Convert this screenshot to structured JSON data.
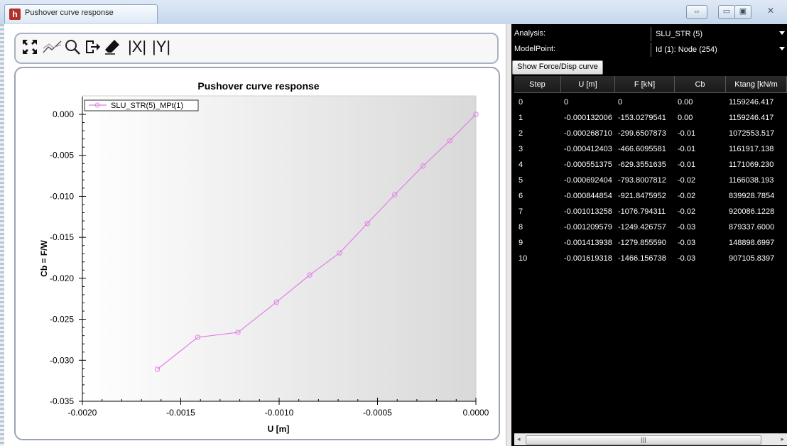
{
  "window": {
    "title": "Pushover curve response",
    "app_icon": "app-logo-icon"
  },
  "window_buttons": {
    "restore_arrows": "⇔",
    "minimize": "▭",
    "maximize": "▣",
    "close": "✕"
  },
  "toolbar": {
    "icons": [
      "fit-view-icon",
      "line-chart-icon",
      "zoom-icon",
      "export-icon",
      "eraser-icon"
    ],
    "abs_x_label": "|X|",
    "abs_y_label": "|Y|"
  },
  "right_panel": {
    "analysis_label": "Analysis:",
    "analysis_value": "SLU_STR (5)",
    "modelpoint_label": "ModelPoint:",
    "modelpoint_value": "Id (1): Node (254)",
    "show_button": "Show Force/Disp curve",
    "columns": [
      "Step",
      "U [m]",
      "F [kN]",
      "Cb",
      "Ktang [kN/m"
    ],
    "rows": [
      [
        "0",
        "0",
        "0",
        "0.00",
        "1159246.417"
      ],
      [
        "1",
        "-0.000132006",
        "-153.0279541",
        "0.00",
        "1159246.417"
      ],
      [
        "2",
        "-0.000268710",
        "-299.6507873",
        "-0.01",
        "1072553.517"
      ],
      [
        "3",
        "-0.000412403",
        "-466.6095581",
        "-0.01",
        "1161917.138"
      ],
      [
        "4",
        "-0.000551375",
        "-629.3551635",
        "-0.01",
        "1171069.230"
      ],
      [
        "5",
        "-0.000692404",
        "-793.8007812",
        "-0.02",
        "1166038.193"
      ],
      [
        "6",
        "-0.000844854",
        "-921.8475952",
        "-0.02",
        "839928.7854"
      ],
      [
        "7",
        "-0.001013258",
        "-1076.794311",
        "-0.02",
        "920086.1228"
      ],
      [
        "8",
        "-0.001209579",
        "-1249.426757",
        "-0.03",
        "879337.6000"
      ],
      [
        "9",
        "-0.001413938",
        "-1279.855590",
        "-0.03",
        "148898.6997"
      ],
      [
        "10",
        "-0.001619318",
        "-1466.156738",
        "-0.03",
        "907105.8397"
      ]
    ],
    "scroll_thumb": "|||"
  },
  "chart_data": {
    "type": "line",
    "title": "Pushover curve response",
    "xlabel": "U [m]",
    "ylabel": "Cb = F/W",
    "xlim": [
      -0.002,
      0.0
    ],
    "ylim": [
      -0.035,
      0.0
    ],
    "xticks": [
      "-0.0020",
      "-0.0015",
      "-0.0010",
      "-0.0005",
      "0.0000"
    ],
    "yticks": [
      "0.000",
      "-0.005",
      "-0.010",
      "-0.015",
      "-0.020",
      "-0.025",
      "-0.030",
      "-0.035"
    ],
    "grid": false,
    "legend_position": "top-left",
    "series": [
      {
        "name": "SLU_STR(5)_MPt(1)",
        "color": "#e37de8",
        "marker": "circle",
        "x": [
          0,
          -0.000132006,
          -0.00026871,
          -0.000412403,
          -0.000551375,
          -0.000692404,
          -0.000844854,
          -0.001013258,
          -0.001209579,
          -0.001413938,
          -0.001619318
        ],
        "y": [
          0,
          -0.0032,
          -0.0063,
          -0.0098,
          -0.0133,
          -0.0169,
          -0.0196,
          -0.0229,
          -0.0266,
          -0.0272,
          -0.0311
        ]
      }
    ]
  }
}
